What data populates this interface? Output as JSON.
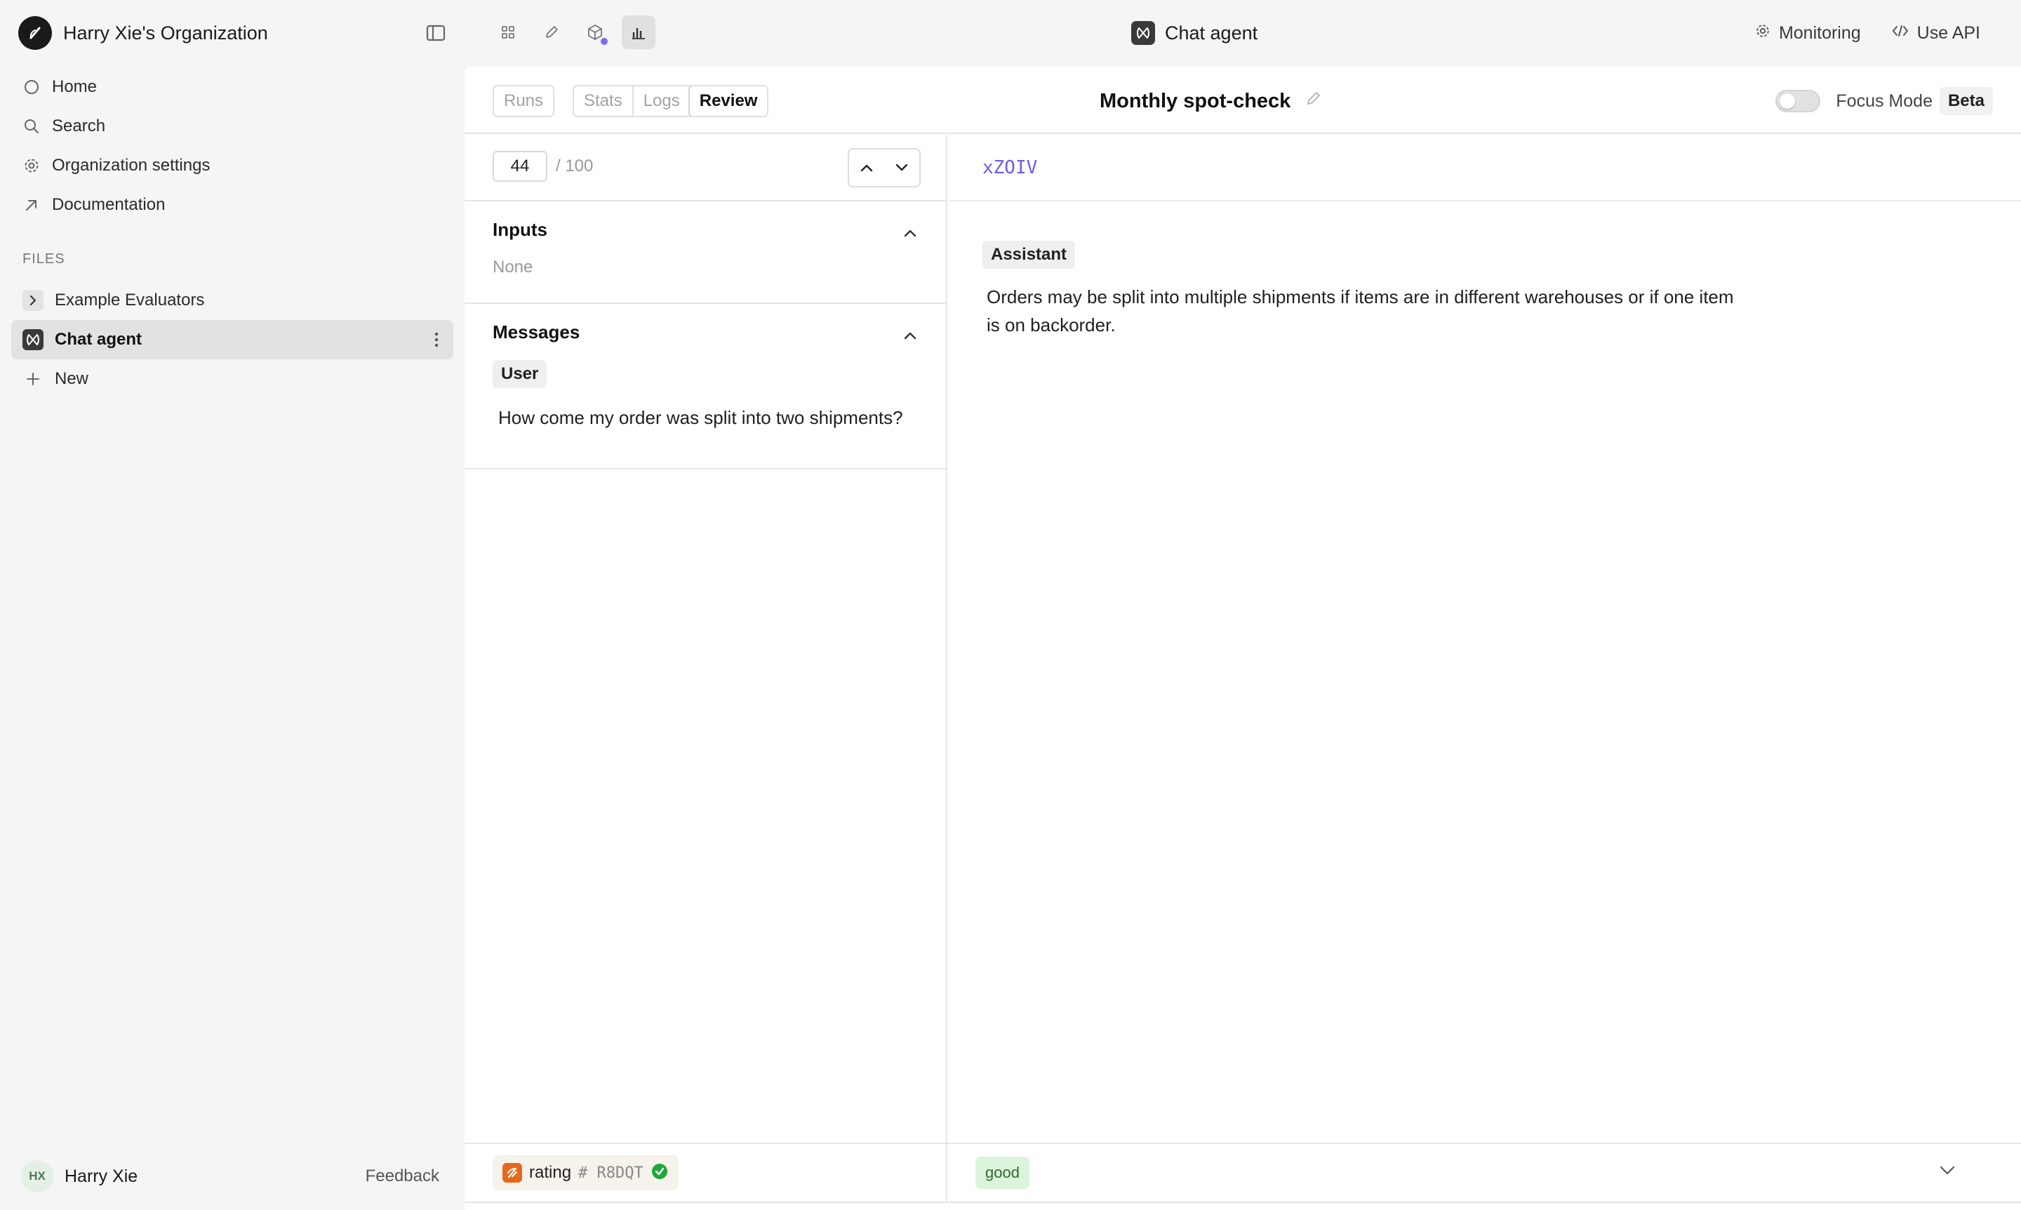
{
  "sidebar": {
    "org_name": "Harry Xie's Organization",
    "nav": [
      {
        "label": "Home",
        "icon": "circle-icon"
      },
      {
        "label": "Search",
        "icon": "search-icon"
      },
      {
        "label": "Organization settings",
        "icon": "gear-icon"
      },
      {
        "label": "Documentation",
        "icon": "external-arrow-icon"
      }
    ],
    "files_label": "FILES",
    "files": [
      {
        "label": "Example Evaluators",
        "icon": "chevron-right-icon"
      },
      {
        "label": "Chat agent",
        "icon": "agent-icon",
        "active": true
      },
      {
        "label": "New",
        "icon": "plus-icon"
      }
    ],
    "user": {
      "initials": "HX",
      "name": "Harry Xie"
    },
    "feedback_label": "Feedback"
  },
  "topbar": {
    "icons": [
      "grid-icon",
      "pencil-icon",
      "cube-icon",
      "chart-icon"
    ],
    "title": "Chat agent",
    "monitoring_label": "Monitoring",
    "api_label": "Use API"
  },
  "toolbar": {
    "tabs_single": "Runs",
    "tabs": [
      "Stats",
      "Logs",
      "Review"
    ],
    "selected_tab": "Review",
    "review_title": "Monthly spot-check",
    "focus_mode_label": "Focus Mode",
    "beta_label": "Beta"
  },
  "pager": {
    "current": "44",
    "total": "/ 100"
  },
  "inputs": {
    "title": "Inputs",
    "value": "None"
  },
  "messages": {
    "title": "Messages",
    "items": [
      {
        "role": "User",
        "text": "How come my order was split into two shipments?"
      }
    ]
  },
  "output": {
    "id": "xZOIV",
    "role": "Assistant",
    "text": "Orders may be split into multiple shipments if items are in different warehouses or if one item is on backorder."
  },
  "rating": {
    "name": "rating",
    "id": "# R8DQT",
    "value": "good"
  },
  "colors": {
    "accent": "#6b5cf0",
    "good_bg": "#dcf4dc",
    "rating_icon": "#e36a1c",
    "success": "#1fa83c"
  }
}
